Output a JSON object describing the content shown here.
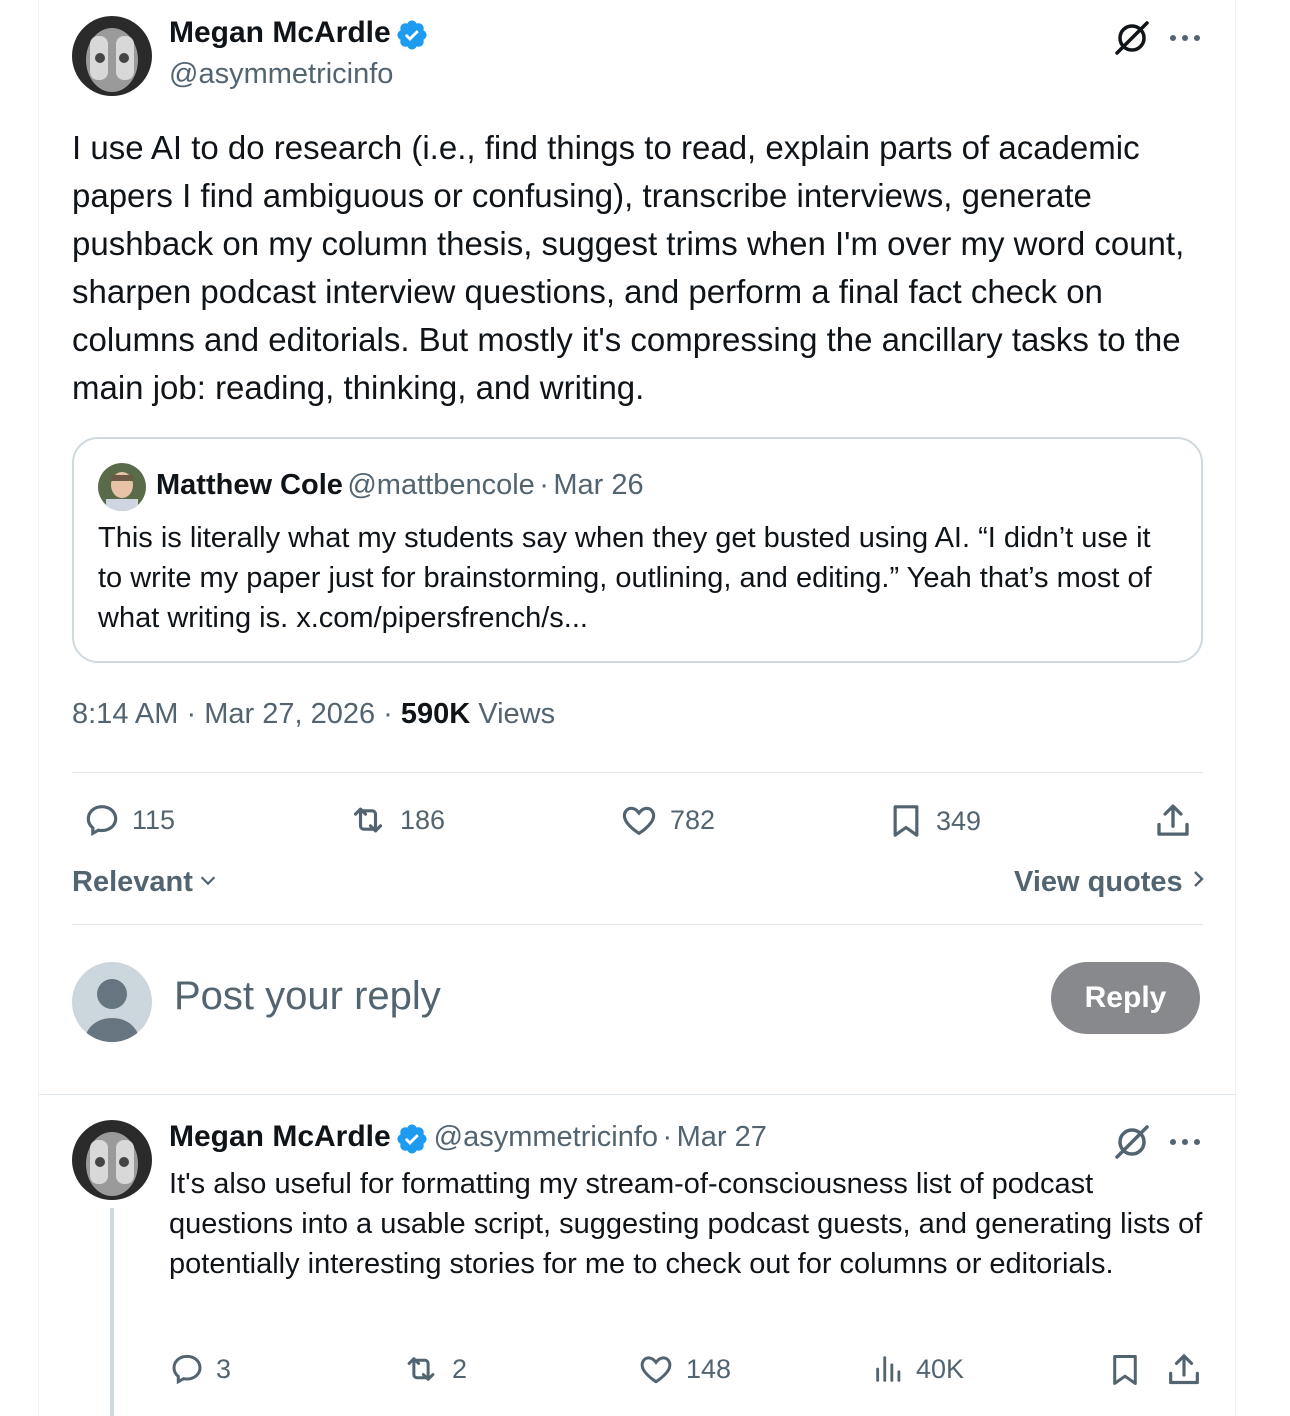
{
  "main_post": {
    "author_name": "Megan McArdle",
    "author_handle": "@asymmetricinfo",
    "body": "I use AI to do research (i.e., find things to read, explain parts of academic papers I find ambiguous or confusing), transcribe interviews, generate pushback on my column thesis, suggest trims when I'm over my word count, sharpen podcast interview questions, and perform a final fact check on columns and editorials. But mostly it's compressing the ancillary tasks to the main job: reading, thinking, and writing.",
    "quote": {
      "author_name": "Matthew Cole",
      "author_handle": "@mattbencole",
      "separator": "·",
      "date": "Mar 26",
      "body": "This is literally what my students say when they get busted using AI. “I didn’t use it to write my paper just for brainstorming, outlining, and editing.” Yeah that’s most of what writing is. x.com/pipersfrench/s..."
    },
    "meta": {
      "time": "8:14 AM",
      "separator": "·",
      "date": "Mar 27, 2026",
      "separator2": "·",
      "views_count": "590K",
      "views_label": "Views"
    },
    "actions": {
      "replies": "115",
      "reposts": "186",
      "likes": "782",
      "bookmarks": "349"
    },
    "sort_label": "Relevant",
    "view_quotes_label": "View quotes"
  },
  "composer": {
    "placeholder": "Post your reply",
    "reply_label": "Reply"
  },
  "reply_post": {
    "author_name": "Megan McArdle",
    "author_handle": "@asymmetricinfo",
    "separator": "·",
    "date": "Mar 27",
    "body": "It's also useful for formatting my stream-of-consciousness list of podcast questions into a usable script, suggesting podcast guests, and generating lists of potentially interesting stories for me to check out for columns or editorials.",
    "actions": {
      "replies": "3",
      "reposts": "2",
      "likes": "148",
      "views": "40K"
    }
  },
  "colors": {
    "text": "#0f1419",
    "muted": "#536471",
    "verified": "#1d9bf0",
    "border": "#cfd9de",
    "reply_button_bg": "#87898c"
  },
  "icons": [
    "grok-icon",
    "more-icon",
    "verified-badge-icon",
    "reply-icon",
    "repost-icon",
    "like-icon",
    "bookmark-icon",
    "share-icon",
    "views-icon",
    "chevron-down-icon",
    "chevron-right-icon"
  ]
}
